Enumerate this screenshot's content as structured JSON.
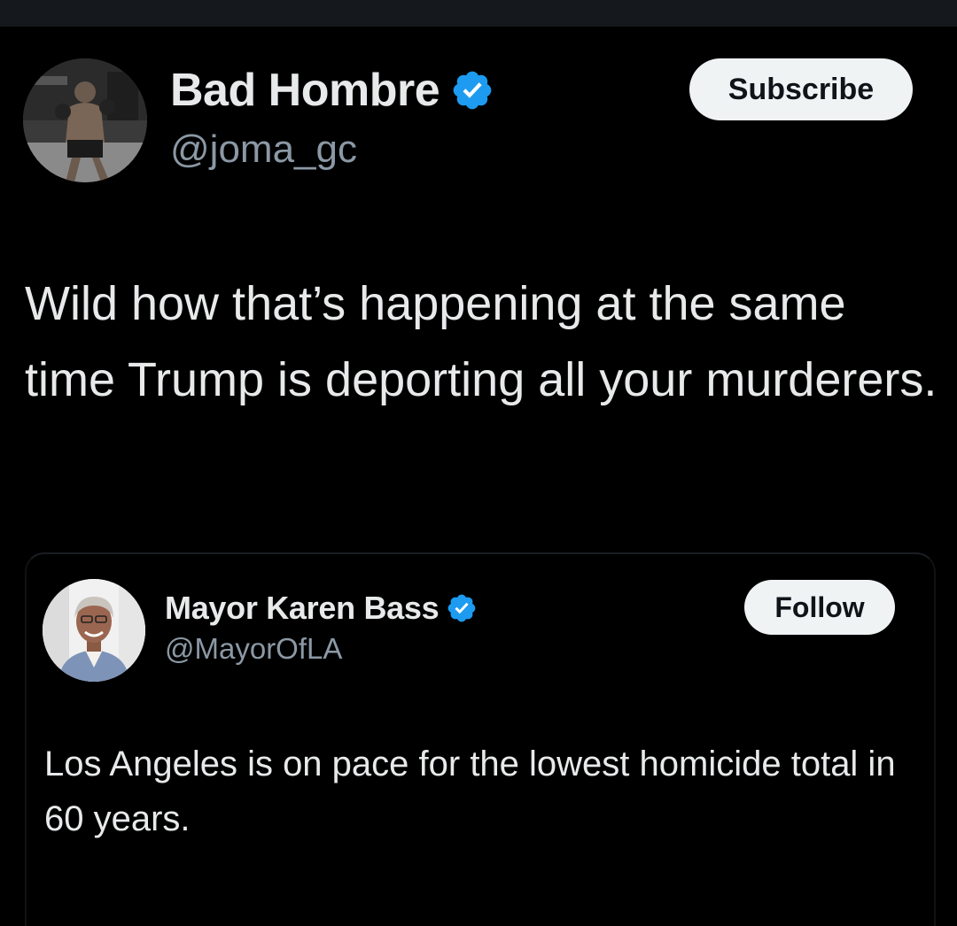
{
  "tweet": {
    "author": {
      "display_name": "Bad Hombre",
      "handle": "@joma_gc",
      "verified": true,
      "avatar_icon": "avatar-boxer-photo"
    },
    "subscribe_label": "Subscribe",
    "text": "Wild how that’s happening at the same time Trump is deporting all your murderers."
  },
  "quoted_tweet": {
    "author": {
      "display_name": "Mayor Karen Bass",
      "handle": "@MayorOfLA",
      "verified": true,
      "avatar_icon": "avatar-woman-photo"
    },
    "follow_label": "Follow",
    "text": "Los Angeles is on pace for the lowest homicide total in 60 years."
  },
  "colors": {
    "background": "#000000",
    "text_primary": "#e7e9ea",
    "text_secondary": "#8b98a5",
    "verified_badge": "#1d9bf0",
    "button_bg": "#eff3f4"
  }
}
